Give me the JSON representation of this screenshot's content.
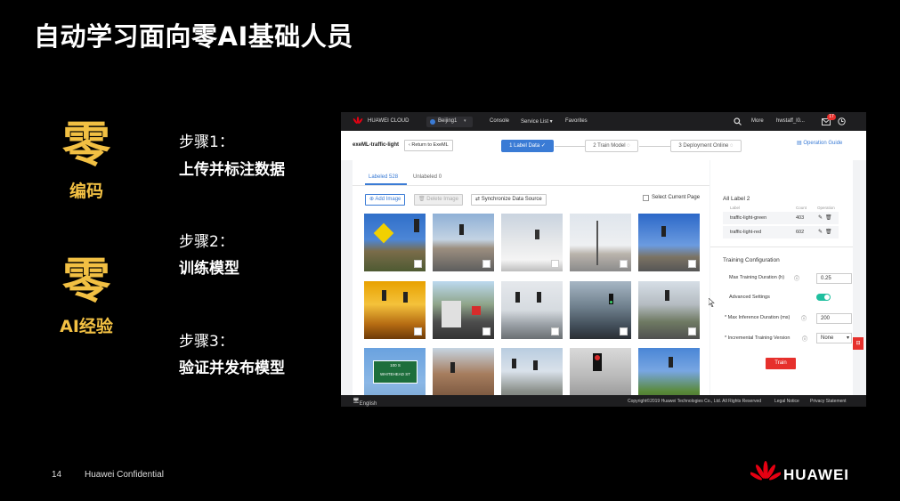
{
  "slide": {
    "title": "自动学习面向零AI基础人员",
    "left_blocks": [
      {
        "big": "零",
        "caption": "编码"
      },
      {
        "big": "零",
        "caption": "AI经验"
      }
    ],
    "steps": [
      {
        "label": "步骤1：",
        "text": "上传并标注数据"
      },
      {
        "label": "步骤2：",
        "text": "训练模型"
      },
      {
        "label": "步骤3：",
        "text": "验证并发布模型"
      }
    ],
    "page_number": "14",
    "confidential": "Huawei Confidential",
    "logo_text": "HUAWEI",
    "colors": {
      "accent": "#f2c043",
      "background": "#000000",
      "logo_red": "#e60012"
    }
  },
  "console": {
    "topbar": {
      "brand": "HUAWEI CLOUD",
      "region": "Beijing1",
      "nav": [
        "Console",
        "Service List ▾",
        "Favorites"
      ],
      "more": "More",
      "user": "hwstaff_l0...",
      "badge": "17",
      "icons": [
        "search-icon",
        "mail-icon",
        "clock-icon"
      ]
    },
    "subbar": {
      "project": "exeML-traffic-light",
      "back": "Return to ExeML",
      "steps": [
        "1 Label Data",
        "2 Train Model",
        "3 Deployment Online"
      ],
      "guide": "Operation Guide"
    },
    "tabs": [
      "Labeled 528",
      "Unlabeled 0"
    ],
    "toolbar": {
      "add": "Add Image",
      "delete": "Delete Image",
      "sync": "Synchronize Data Source",
      "select_current": "Select Current Page"
    },
    "labels": {
      "heading": "All Label",
      "count": "2",
      "columns": [
        "Label",
        "Count",
        "Operation"
      ],
      "rows": [
        {
          "name": "traffic-light-green",
          "count": "403"
        },
        {
          "name": "traffic-light-red",
          "count": "602"
        }
      ]
    },
    "training": {
      "heading": "Training Configuration",
      "max_duration_label": "Max Training Duration (h)",
      "max_duration_value": "0.25",
      "advanced_label": "Advanced Settings",
      "inference_label": "Max Inference Duration (ms)",
      "inference_value": "200",
      "incremental_label": "Incremental Training Version",
      "incremental_value": "None",
      "train_button": "Train"
    },
    "street_sign": {
      "line1": "100 S",
      "line2": "WHITEHEAD ST"
    },
    "footer": {
      "language": "English",
      "copyright": "Copyright©2019 Huawei Technologies Co., Ltd. All Rights Reserved",
      "links": [
        "Legal Notice",
        "Privacy Statement"
      ]
    },
    "colors": {
      "primary": "#3a7bd5",
      "toggle": "#1fbf9f",
      "train": "#e6302c"
    }
  }
}
